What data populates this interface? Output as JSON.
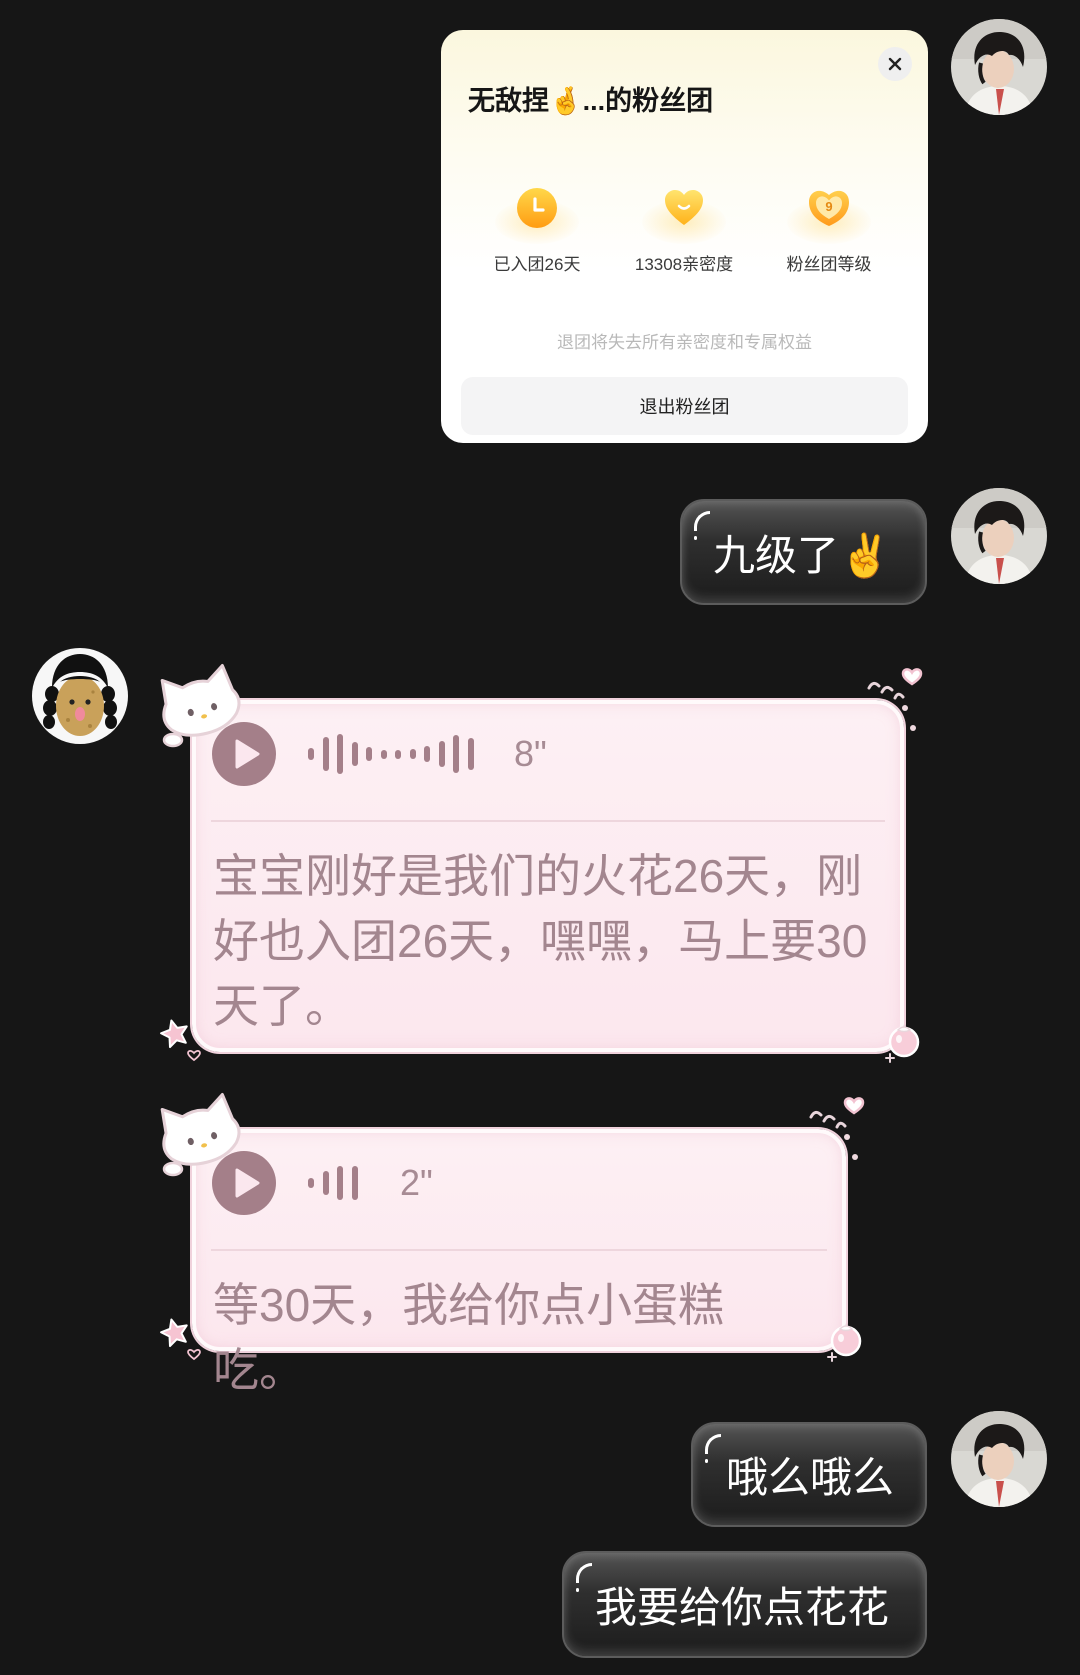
{
  "screen": {
    "background": "#161616"
  },
  "avatars": {
    "self": "boy-avatar",
    "other": "potato-girl-avatar"
  },
  "fan_card": {
    "title": "无敌捏🤞...的粉丝团",
    "close_icon": "close-icon",
    "stats": [
      {
        "icon": "clock-icon",
        "label": "已入团26天"
      },
      {
        "icon": "smiling-heart-icon",
        "label": "13308亲密度"
      },
      {
        "icon": "fan-level-badge-icon",
        "badge": "9",
        "label": "粉丝团等级"
      }
    ],
    "warning": "退团将失去所有亲密度和专属权益",
    "quit_button": "退出粉丝团"
  },
  "messages": {
    "sent_1": {
      "text": "九级了✌️"
    },
    "voice_1": {
      "play_icon": "play-icon",
      "duration": "8\"",
      "transcript": "宝宝刚好是我们的火花26天，刚好也入团26天，嘿嘿，马上要30天了。"
    },
    "voice_2": {
      "play_icon": "play-icon",
      "duration": "2\"",
      "transcript": "等30天，我给你点小蛋糕吃。"
    },
    "sent_2": {
      "text": "哦么哦么"
    },
    "sent_3": {
      "text": "我要给你点花花"
    }
  },
  "decorations": {
    "voice_bubble": [
      "kitty-head-sticker",
      "heart-swirl-sticker",
      "star-sticker",
      "strawberry-sticker"
    ]
  },
  "colors": {
    "background": "#161616",
    "card": "#ffffff",
    "card_tint": "#fbf7de",
    "sent_bubble": "#2f2f2f",
    "sent_text": "#ffffff",
    "voice_bubble": "#fce9ef",
    "voice_text": "#a3868f",
    "play_button": "#a47f89",
    "accent_orange": "#ff9c12"
  }
}
